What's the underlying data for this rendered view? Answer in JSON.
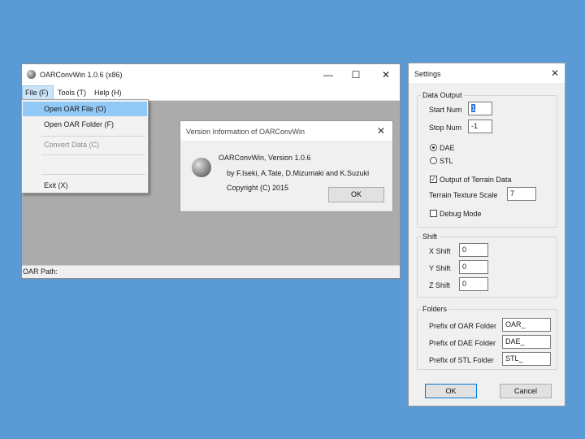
{
  "main_window": {
    "title": "OARConvWin 1.0.6 (x86)",
    "controls": {
      "minimize": "—",
      "maximize": "☐",
      "close": "✕"
    },
    "menu": [
      "File (F)",
      "Tools (T)",
      "Help (H)"
    ],
    "status": "OAR Path:"
  },
  "file_menu": {
    "open_file": "Open OAR File (O)",
    "open_folder": "Open OAR Folder (F)",
    "convert": "Convert Data (C)",
    "exit": "Exit (X)"
  },
  "version_dialog": {
    "title": "Version Information of OARConvWin",
    "close": "✕",
    "line1": "OARConvWin, Version 1.0.6",
    "line2": "by F.Iseki, A.Tate, D.Mizumaki and K.Suzuki",
    "line3": "Copyright (C) 2015",
    "ok": "OK"
  },
  "settings": {
    "title": "Settings",
    "close": "✕",
    "data_output": {
      "label": "Data Output",
      "start_num_label": "Start Num",
      "start_num": "1",
      "stop_num_label": "Stop Num",
      "stop_num": "-1",
      "dae": "DAE",
      "stl": "STL",
      "terrain": "Output of Terrain Data",
      "terrain_scale_label": "Terrain Texture Scale",
      "terrain_scale": "7",
      "debug": "Debug Mode"
    },
    "shift": {
      "label": "Shift",
      "x_label": "X Shift",
      "x": "0",
      "y_label": "Y Shift",
      "y": "0",
      "z_label": "Z Shift",
      "z": "0"
    },
    "folders": {
      "label": "Folders",
      "oar_label": "Prefix of OAR Folder",
      "oar": "OAR_",
      "dae_label": "Prefix of DAE Folder",
      "dae": "DAE_",
      "stl_label": "Prefix of STL Folder",
      "stl": "STL_"
    },
    "ok": "OK",
    "cancel": "Cancel"
  }
}
